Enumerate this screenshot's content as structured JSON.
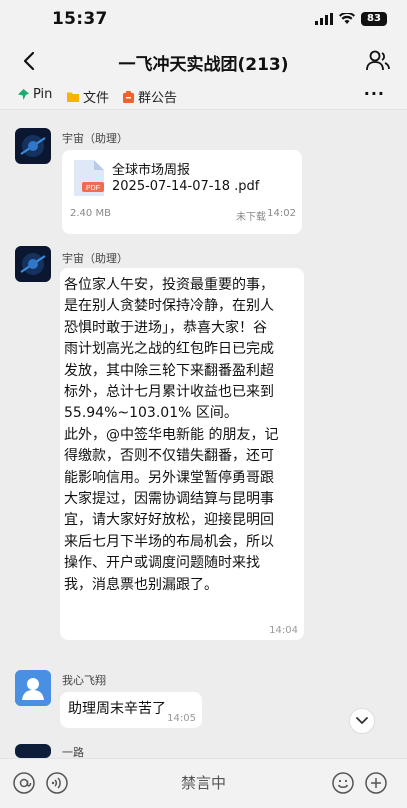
{
  "status_bar": {
    "time": "15:37",
    "battery": "83"
  },
  "nav": {
    "title": "一飞冲天实战团(213)"
  },
  "quick_bar": {
    "pin": "Pin",
    "files": "文件",
    "announcement": "群公告",
    "more": "···"
  },
  "messages": [
    {
      "type": "file",
      "sender": "宇宙（助理）",
      "file_name": "全球市场周报",
      "file_range": "2025-07-14-07-18 .pdf",
      "file_type": "PDF",
      "size": "2.40 MB",
      "status": "未下载",
      "time": "14:02"
    },
    {
      "type": "text",
      "sender": "宇宙（助理）",
      "text": "各位家人午安，投资最重要的事，\n是在别人贪婪时保持冷静，在别人\n恐惧时敢于进场」，恭喜大家！谷\n雨计划高光之战的红包昨日已完成\n发放，其中除三轮下来翻番盈利超\n标外，总计七月累计收益也已来到\n55.94%~103.01% 区间。\n此外，@中签华电新能 的朋友，记\n得缴款，否则不仅错失翻番，还可\n能影响信用。另外课堂暂停勇哥跟\n大家提过，因需协调结算与昆明事\n宜，请大家好好放松，迎接昆明回\n来后七月下半场的布局机会，所以\n操作、开户或调度问题随时来找\n我，消息票也别漏跟了。",
      "time": "14:04"
    },
    {
      "type": "text",
      "sender": "我心飞翔",
      "text": "助理周末辛苦了",
      "time": "14:05"
    },
    {
      "type": "partial",
      "sender": "一路"
    }
  ],
  "input_bar": {
    "muted_label": "禁言中"
  },
  "colors": {
    "pin": "#1aad6e",
    "folder": "#f5b400",
    "announcement": "#f0612b",
    "avatar_user": "#4a90e2",
    "pdf": "#f36b4f"
  },
  "icons": [
    "back-icon",
    "members-icon",
    "pin-icon",
    "folder-icon",
    "announcement-icon",
    "more-icon",
    "pdf-icon",
    "chevron-down-icon",
    "mention-icon",
    "voice-icon",
    "emoji-icon",
    "plus-icon"
  ]
}
